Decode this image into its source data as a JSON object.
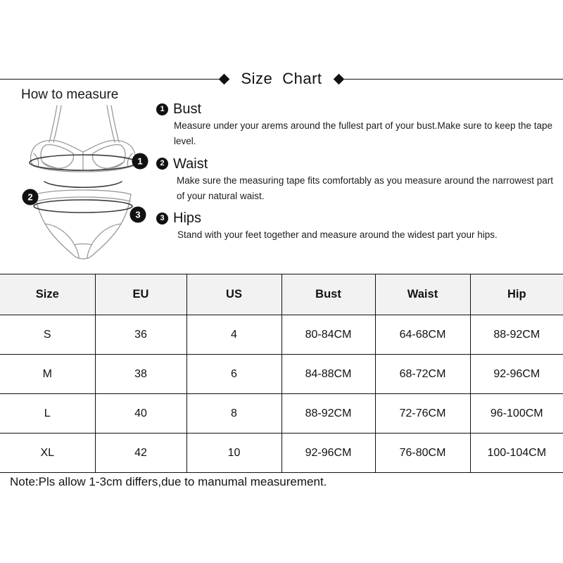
{
  "header": {
    "title_left": "Size",
    "title_right": "Chart",
    "diamond_icon": "diamond-marker"
  },
  "how_to_measure": {
    "heading": "How to measure",
    "illustration_alt": "bikini-top-and-bottom-measurement-diagram",
    "callouts": [
      {
        "number": "1",
        "target": "bust-line"
      },
      {
        "number": "2",
        "target": "waist-line"
      },
      {
        "number": "3",
        "target": "hip-line"
      }
    ]
  },
  "instructions": [
    {
      "number": "1",
      "title": "Bust",
      "body": "Measure under your arems around the fullest part of your bust.Make sure to keep the tape level."
    },
    {
      "number": "2",
      "title": "Waist",
      "body": "Make sure the measuring tape fits comfortably as you measure around the narrowest part of your natural waist."
    },
    {
      "number": "3",
      "title": "Hips",
      "body": "Stand with your feet together and measure around the widest part your hips."
    }
  ],
  "chart_data": {
    "type": "table",
    "title": "Size Chart",
    "columns": [
      "Size",
      "EU",
      "US",
      "Bust",
      "Waist",
      "Hip"
    ],
    "rows": [
      [
        "S",
        "36",
        "4",
        "80-84CM",
        "64-68CM",
        "88-92CM"
      ],
      [
        "M",
        "38",
        "6",
        "84-88CM",
        "68-72CM",
        "92-96CM"
      ],
      [
        "L",
        "40",
        "8",
        "88-92CM",
        "72-76CM",
        "96-100CM"
      ],
      [
        "XL",
        "42",
        "10",
        "92-96CM",
        "76-80CM",
        "100-104CM"
      ]
    ]
  },
  "footer": {
    "note": "Note:Pls allow 1-3cm differs,due to manumal measurement."
  },
  "colors": {
    "text": "#141414",
    "border": "#111111",
    "header_background": "#f2f2f2",
    "badge_background": "#111111",
    "page_background": "#ffffff"
  }
}
